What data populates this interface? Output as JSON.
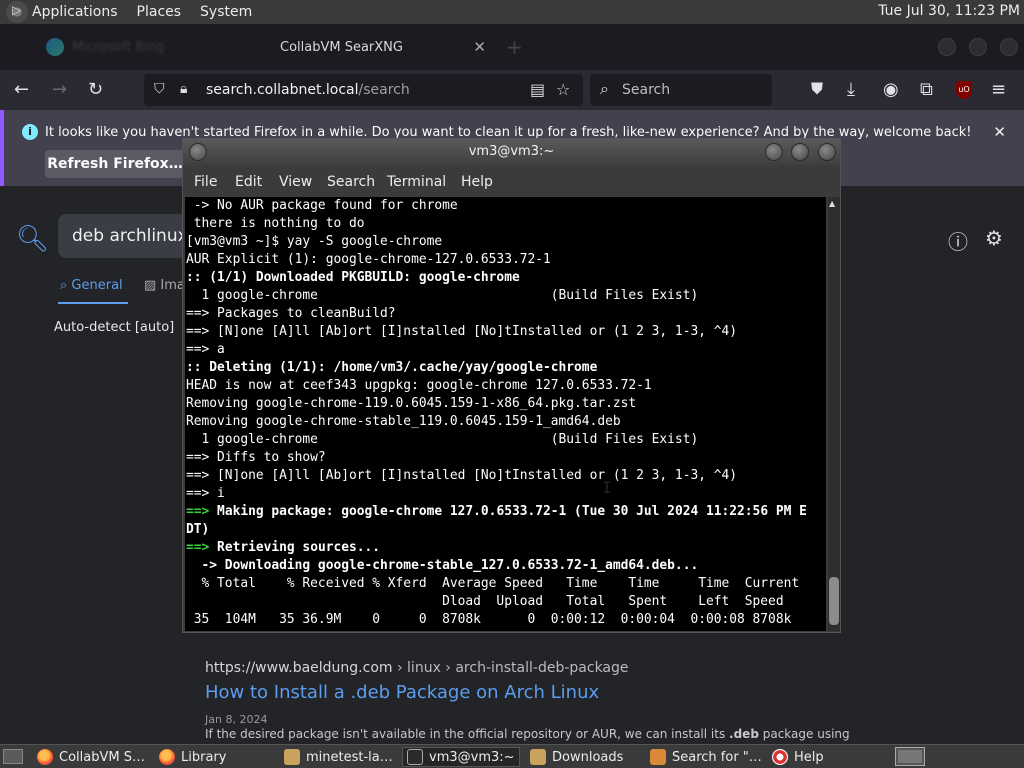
{
  "top_panel": {
    "menus": [
      "Applications",
      "Places",
      "System"
    ],
    "clock": "Tue Jul 30, 11:23 PM"
  },
  "browser": {
    "inactive_tab_title": "Microsoft Bing",
    "active_tab_title": "CollabVM SearXNG",
    "url_domain": "search.collabnet.local",
    "url_path": "/search",
    "search_placeholder": "Search",
    "ublock_label": "uO",
    "notification": {
      "message": "It looks like you haven't started Firefox in a while. Do you want to clean it up for a fresh, like-new experience? And by the way, welcome back!",
      "button": "Refresh Firefox…"
    }
  },
  "searx": {
    "query": "deb archlinux",
    "categories": {
      "general": "General",
      "images": "Ima"
    },
    "language": "Auto-detect [auto]",
    "result": {
      "url_host": "https://www.baeldung.com",
      "url_path": " › linux › arch-install-deb-package",
      "title": "How to Install a .deb Package on Arch Linux",
      "date": "Jan 8, 2024",
      "snippet_pre": "If the desired package isn't available in the official repository or AUR, we can install its ",
      "snippet_bold": ".deb",
      "snippet_post": " package using"
    }
  },
  "terminal": {
    "title": "vm3@vm3:~",
    "menu": [
      "File",
      "Edit",
      "View",
      "Search",
      "Terminal",
      "Help"
    ],
    "lines": [
      {
        "t": " -> No AUR package found for chrome",
        "s": ""
      },
      {
        "t": " there is nothing to do",
        "s": ""
      },
      {
        "t": "[vm3@vm3 ~]$ yay -S google-chrome",
        "s": ""
      },
      {
        "t": "AUR Explicit (1): google-chrome-127.0.6533.72-1",
        "s": ""
      },
      {
        "t": ":: (1/1) Downloaded PKGBUILD: google-chrome",
        "s": "bold"
      },
      {
        "t": "  1 google-chrome                              (Build Files Exist)",
        "s": ""
      },
      {
        "t": "==> Packages to cleanBuild?",
        "s": ""
      },
      {
        "t": "==> [N]one [A]ll [Ab]ort [I]nstalled [No]tInstalled or (1 2 3, 1-3, ^4)",
        "s": ""
      },
      {
        "t": "==> a",
        "s": ""
      },
      {
        "t": ":: Deleting (1/1): /home/vm3/.cache/yay/google-chrome",
        "s": "bold"
      },
      {
        "t": "HEAD is now at ceef343 upgpkg: google-chrome 127.0.6533.72-1",
        "s": ""
      },
      {
        "t": "Removing google-chrome-119.0.6045.159-1-x86_64.pkg.tar.zst",
        "s": ""
      },
      {
        "t": "Removing google-chrome-stable_119.0.6045.159-1_amd64.deb",
        "s": ""
      },
      {
        "t": "  1 google-chrome                              (Build Files Exist)",
        "s": ""
      },
      {
        "t": "==> Diffs to show?",
        "s": ""
      },
      {
        "t": "==> [N]one [A]ll [Ab]ort [I]nstalled [No]tInstalled or (1 2 3, 1-3, ^4)",
        "s": ""
      },
      {
        "t": "==> i",
        "s": ""
      },
      {
        "p": "==>",
        "t": " Making package: google-chrome 127.0.6533.72-1 (Tue 30 Jul 2024 11:22:56 PM E",
        "s": "bold"
      },
      {
        "t": "DT)",
        "s": "bold"
      },
      {
        "p": "==>",
        "t": " Retrieving sources...",
        "s": "bold"
      },
      {
        "t": "  -> Downloading google-chrome-stable_127.0.6533.72-1_amd64.deb...",
        "s": "bold"
      },
      {
        "t": "  % Total    % Received % Xferd  Average Speed   Time    Time     Time  Current",
        "s": ""
      },
      {
        "t": "                                 Dload  Upload   Total   Spent    Left  Speed",
        "s": ""
      },
      {
        "t": " 35  104M   35 36.9M    0     0  8708k      0  0:00:12  0:00:04  0:00:08 8708k",
        "s": ""
      }
    ]
  },
  "taskbar": [
    {
      "label": "CollabVM S…",
      "icon": "firefox-icon",
      "active": false
    },
    {
      "label": "Library",
      "icon": "firefox-icon",
      "active": false
    },
    {
      "label": "minetest-la…",
      "icon": "folder-icon",
      "active": false
    },
    {
      "label": "vm3@vm3:~",
      "icon": "terminal-icon",
      "active": true
    },
    {
      "label": "Downloads",
      "icon": "folder-icon",
      "active": false
    },
    {
      "label": "Search for \"…",
      "icon": "search-icon",
      "active": false
    },
    {
      "label": "Help",
      "icon": "help-icon",
      "active": false
    }
  ]
}
